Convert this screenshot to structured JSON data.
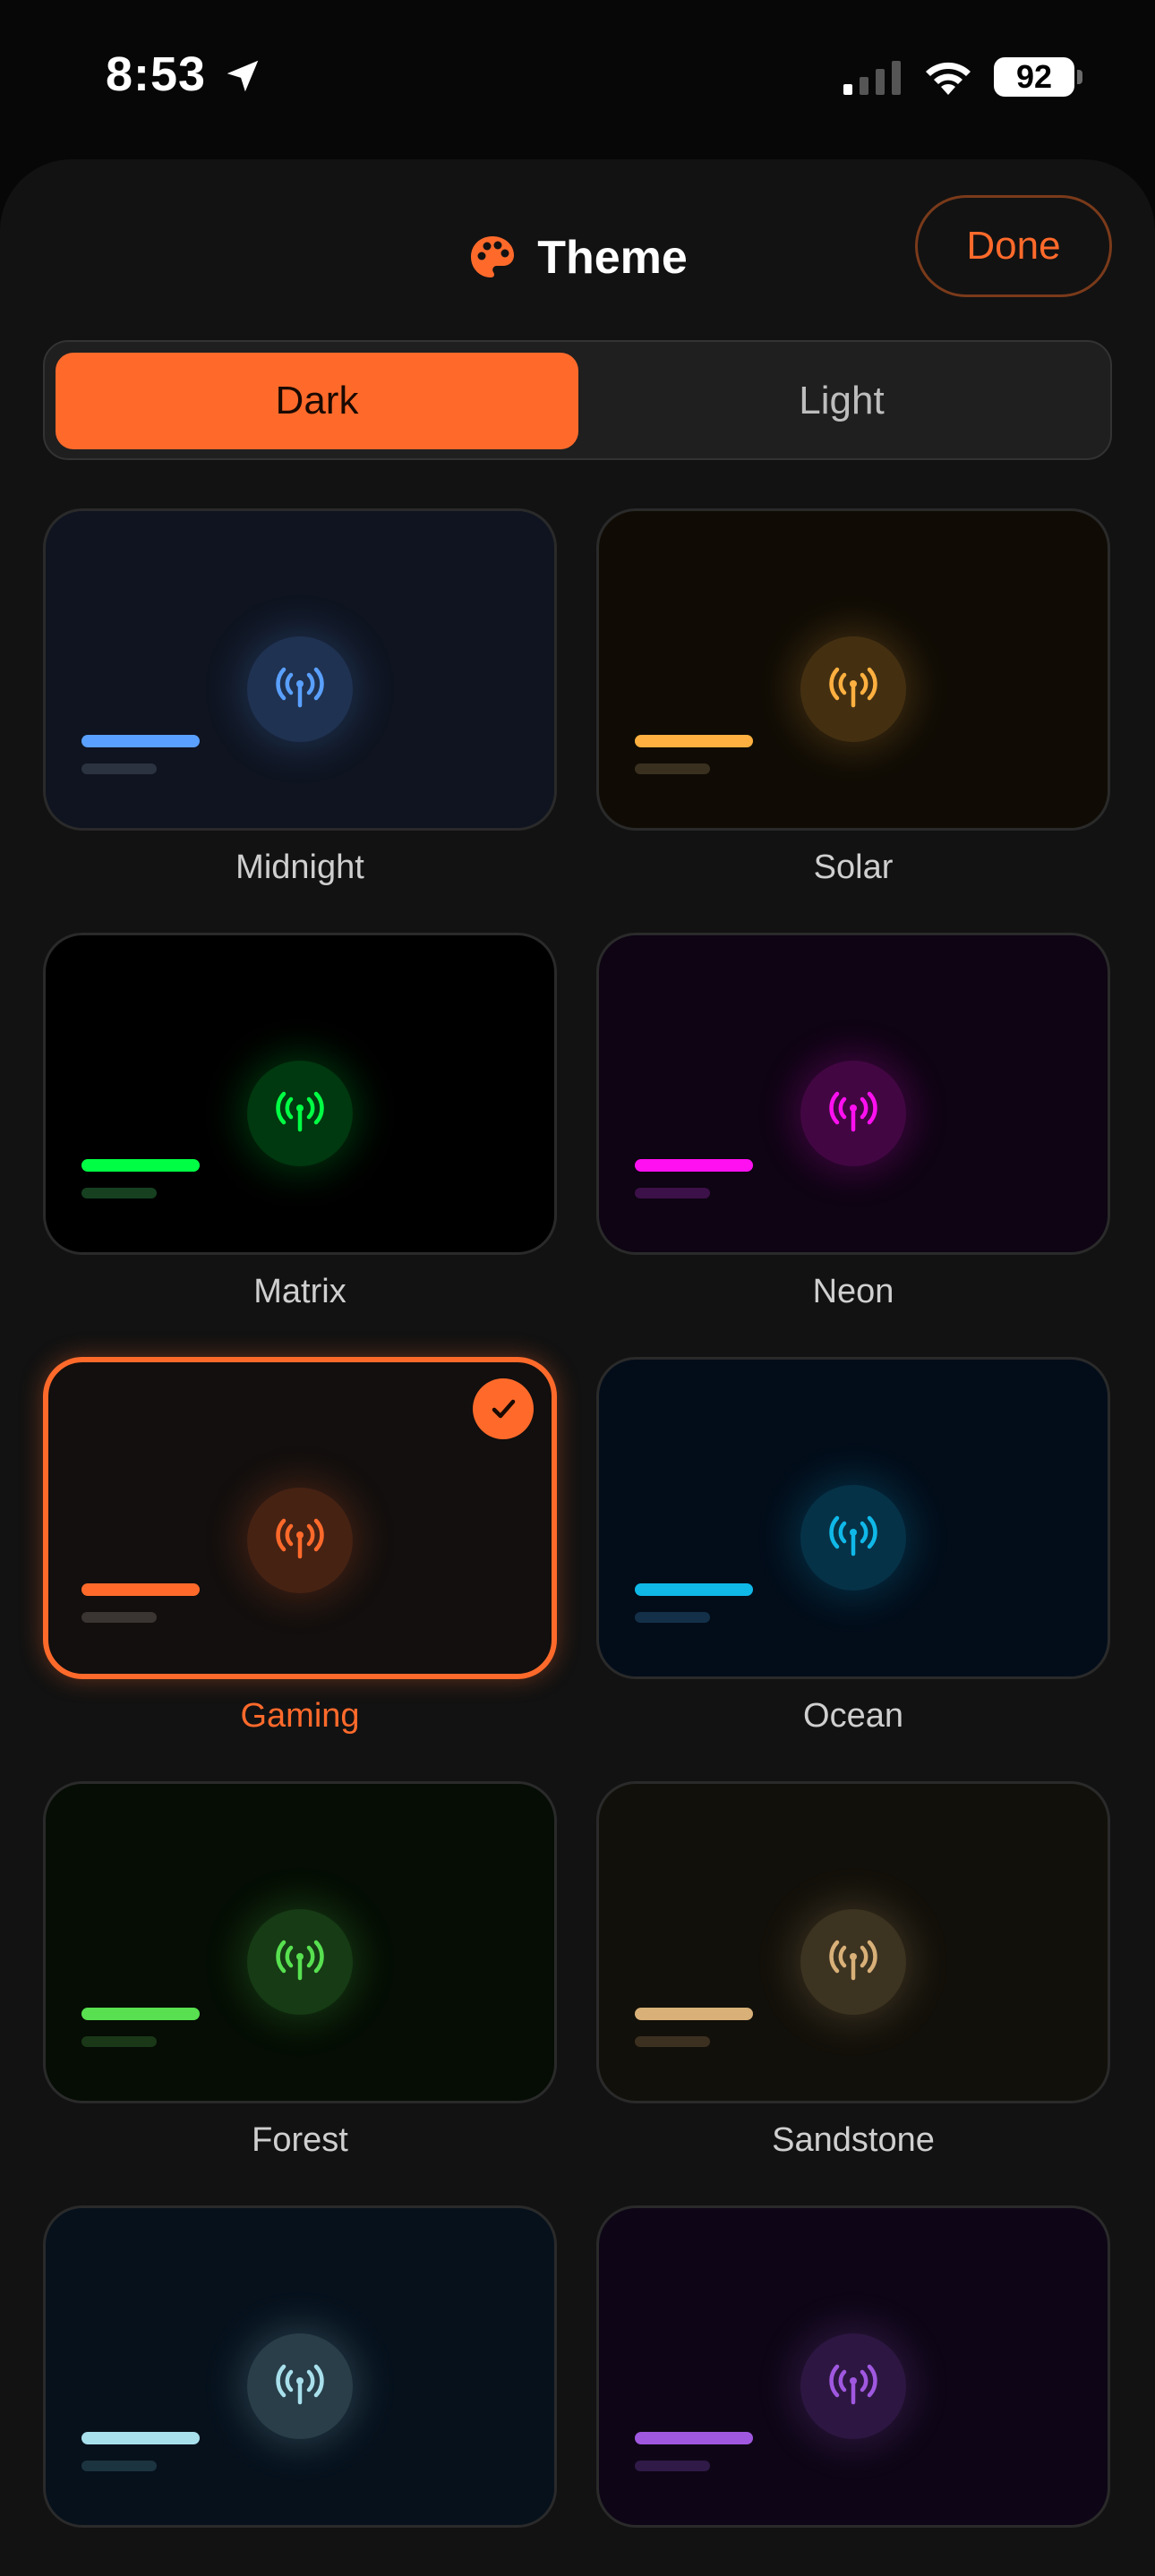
{
  "status": {
    "time": "8:53",
    "battery": "92"
  },
  "header": {
    "title": "Theme",
    "done_label": "Done"
  },
  "modes": {
    "dark": "Dark",
    "light": "Light",
    "selected": "Dark"
  },
  "themes": [
    {
      "name": "Midnight",
      "bg": "#0f1420",
      "accent": "#5aa0ff",
      "sub": "#2c3340",
      "selected": false
    },
    {
      "name": "Solar",
      "bg": "#100c05",
      "accent": "#ffb040",
      "sub": "#3a3020",
      "selected": false
    },
    {
      "name": "Matrix",
      "bg": "#000000",
      "accent": "#00ff44",
      "sub": "#164020",
      "selected": false
    },
    {
      "name": "Neon",
      "bg": "#0e0413",
      "accent": "#ff10f0",
      "sub": "#3c1048",
      "selected": false
    },
    {
      "name": "Gaming",
      "bg": "#120f0e",
      "accent": "#ff6a2b",
      "sub": "#3a3432",
      "selected": true
    },
    {
      "name": "Ocean",
      "bg": "#030d1a",
      "accent": "#10b8e8",
      "sub": "#143048",
      "selected": false
    },
    {
      "name": "Forest",
      "bg": "#050d04",
      "accent": "#58e050",
      "sub": "#1a3818",
      "selected": false
    },
    {
      "name": "Sandstone",
      "bg": "#12100a",
      "accent": "#d8b078",
      "sub": "#3c3020",
      "selected": false
    },
    {
      "name": "",
      "bg": "#06111c",
      "accent": "#a8e0ec",
      "sub": "#1c3440",
      "selected": false
    },
    {
      "name": "",
      "bg": "#0e0616",
      "accent": "#a058e0",
      "sub": "#301a48",
      "selected": false
    }
  ]
}
